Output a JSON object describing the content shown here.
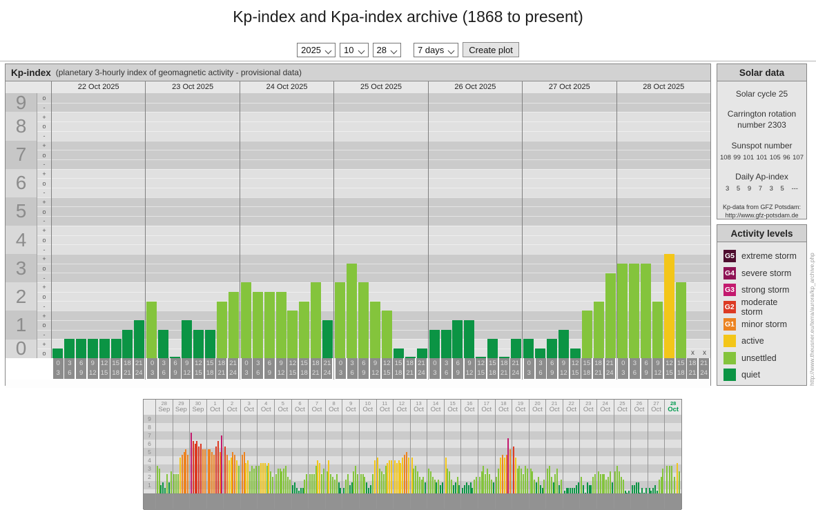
{
  "page": {
    "title": "Kp-index and Kpa-index archive (1868 to present)"
  },
  "controls": {
    "year": "2025",
    "month": "10",
    "day": "28",
    "range": "7 days",
    "create_button": "Create plot"
  },
  "main_chart": {
    "title": "Kp-index",
    "subtitle": "(planetary 3-hourly index of geomagnetic activity - provisional data)",
    "y_labels": [
      "9",
      "8",
      "7",
      "6",
      "5",
      "4",
      "3",
      "2",
      "1",
      "0"
    ],
    "hour_labels": [
      [
        "0",
        "3"
      ],
      [
        "3",
        "6"
      ],
      [
        "6",
        "9"
      ],
      [
        "9",
        "12"
      ],
      [
        "12",
        "15"
      ],
      [
        "15",
        "18"
      ],
      [
        "18",
        "21"
      ],
      [
        "21",
        "24"
      ]
    ],
    "no_data_marker": "x"
  },
  "solar_data": {
    "title": "Solar data",
    "solar_cycle": "Solar cycle 25",
    "carrington": "Carrington rotation number 2303",
    "sunspot_label": "Sunspot number",
    "sunspot_values": [
      "108",
      "99",
      "101",
      "101",
      "105",
      "96",
      "107"
    ],
    "ap_label": "Daily Ap-index",
    "ap_values": [
      "3",
      "5",
      "9",
      "7",
      "3",
      "5",
      "---"
    ],
    "source_line1": "Kp-data from GFZ Potsdam:",
    "source_line2": "http://www.gfz-potsdam.de"
  },
  "activity_levels": {
    "title": "Activity levels",
    "items": [
      {
        "badge": "G5",
        "label": "extreme storm",
        "color": "#4d0d2e"
      },
      {
        "badge": "G4",
        "label": "severe storm",
        "color": "#8e1254"
      },
      {
        "badge": "G3",
        "label": "strong storm",
        "color": "#c31a6e"
      },
      {
        "badge": "G2",
        "label": "moderate storm",
        "color": "#dc3a23"
      },
      {
        "badge": "G1",
        "label": "minor storm",
        "color": "#ec8321"
      },
      {
        "badge": "",
        "label": "active",
        "color": "#f3c619"
      },
      {
        "badge": "",
        "label": "unsettled",
        "color": "#84c43c"
      },
      {
        "badge": "",
        "label": "quiet",
        "color": "#0b9444"
      }
    ]
  },
  "palette": {
    "g5": "#4d0d2e",
    "g4": "#8e1254",
    "g3": "#c31a6e",
    "g2": "#dc3a23",
    "g1": "#ec8321",
    "active": "#f3c619",
    "unsettled": "#84c43c",
    "quiet": "#0b9444",
    "band_dark": "#cbcbcb",
    "band_light": "#e0e0e0",
    "axis_dark": "#c7c7c7",
    "axis_light": "#d9d9d9"
  },
  "watermark": "http://www.theusner.eu/terra/aurora/kp_archive.php",
  "chart_data": [
    {
      "type": "bar",
      "title": "Kp-index",
      "ylabel": "Kp",
      "ylim": [
        0,
        9
      ],
      "grid": true,
      "x_bins_hours": [
        [
          0,
          3
        ],
        [
          3,
          6
        ],
        [
          6,
          9
        ],
        [
          9,
          12
        ],
        [
          12,
          15
        ],
        [
          15,
          18
        ],
        [
          18,
          21
        ],
        [
          21,
          24
        ]
      ],
      "days": [
        {
          "date": "22 Oct 2025",
          "values": [
            0.33,
            0.67,
            0.67,
            0.67,
            0.67,
            0.67,
            1.0,
            1.33
          ]
        },
        {
          "date": "23 Oct 2025",
          "values": [
            2.0,
            1.0,
            0.0,
            1.33,
            1.0,
            1.0,
            2.0,
            2.33
          ]
        },
        {
          "date": "24 Oct 2025",
          "values": [
            2.67,
            2.33,
            2.33,
            2.33,
            1.67,
            2.0,
            2.67,
            1.33
          ]
        },
        {
          "date": "25 Oct 2025",
          "values": [
            2.67,
            3.33,
            2.67,
            2.0,
            1.67,
            0.33,
            0.0,
            0.33
          ]
        },
        {
          "date": "26 Oct 2025",
          "values": [
            1.0,
            1.0,
            1.33,
            1.33,
            0.0,
            0.67,
            0.0,
            0.67
          ]
        },
        {
          "date": "27 Oct 2025",
          "values": [
            0.67,
            0.33,
            0.67,
            1.0,
            0.33,
            1.67,
            2.0,
            3.0
          ]
        },
        {
          "date": "28 Oct 2025",
          "values": [
            3.33,
            3.33,
            3.33,
            2.0,
            3.67,
            2.67,
            null,
            null
          ]
        }
      ]
    },
    {
      "type": "bar",
      "title": "Kp overview 28 Sep - 28 Oct",
      "ylim": [
        0,
        9
      ],
      "y_labels": [
        "9",
        "8",
        "7",
        "6",
        "5",
        "4",
        "3",
        "2",
        "1"
      ],
      "selected_day": "28 Oct",
      "days": [
        {
          "day": "28",
          "month": "Sep",
          "values": [
            3.33,
            3.0,
            1.0,
            1.33,
            0.67,
            2.33,
            1.33,
            2.67
          ]
        },
        {
          "day": "29",
          "month": "Sep",
          "values": [
            2.33,
            2.33,
            2.33,
            4.33,
            4.67,
            5.0,
            5.33,
            4.67
          ]
        },
        {
          "day": "30",
          "month": "Sep",
          "values": [
            7.33,
            6.33,
            6.0,
            6.33,
            5.67,
            6.0,
            5.33,
            5.33
          ]
        },
        {
          "day": "1",
          "month": "Oct",
          "values": [
            5.33,
            5.33,
            5.0,
            4.67,
            5.67,
            6.33,
            5.0,
            7.0
          ]
        },
        {
          "day": "2",
          "month": "Oct",
          "values": [
            5.67,
            4.67,
            4.0,
            4.33,
            5.0,
            4.67,
            4.0,
            3.33
          ]
        },
        {
          "day": "3",
          "month": "Oct",
          "values": [
            4.67,
            5.0,
            3.67,
            4.0,
            2.67,
            3.33,
            3.0,
            3.33
          ]
        },
        {
          "day": "4",
          "month": "Oct",
          "values": [
            3.33,
            3.67,
            3.67,
            3.67,
            3.33,
            3.67,
            2.67,
            2.0
          ]
        },
        {
          "day": "5",
          "month": "Oct",
          "values": [
            2.33,
            3.0,
            3.0,
            2.67,
            3.0,
            3.33,
            2.0,
            1.67
          ]
        },
        {
          "day": "6",
          "month": "Oct",
          "values": [
            1.0,
            1.33,
            0.67,
            0.33,
            0.67,
            0.67,
            1.67,
            2.33
          ]
        },
        {
          "day": "7",
          "month": "Oct",
          "values": [
            2.33,
            2.33,
            2.33,
            3.33,
            4.0,
            3.67,
            2.33,
            3.0
          ]
        },
        {
          "day": "8",
          "month": "Oct",
          "values": [
            2.67,
            4.0,
            2.33,
            2.0,
            1.67,
            2.33,
            1.33,
            0.67
          ]
        },
        {
          "day": "9",
          "month": "Oct",
          "values": [
            0.67,
            1.67,
            2.33,
            1.0,
            1.33,
            2.67,
            3.33,
            2.33
          ]
        },
        {
          "day": "10",
          "month": "Oct",
          "values": [
            2.33,
            2.33,
            2.0,
            1.33,
            0.67,
            1.0,
            2.33,
            4.0
          ]
        },
        {
          "day": "11",
          "month": "Oct",
          "values": [
            4.33,
            3.0,
            2.67,
            2.33,
            3.33,
            3.67,
            4.0,
            4.0
          ]
        },
        {
          "day": "12",
          "month": "Oct",
          "values": [
            4.0,
            3.67,
            4.0,
            3.67,
            4.33,
            4.67,
            5.0,
            4.33
          ]
        },
        {
          "day": "13",
          "month": "Oct",
          "values": [
            4.33,
            3.0,
            3.33,
            2.67,
            2.0,
            1.67,
            2.0,
            1.33
          ]
        },
        {
          "day": "14",
          "month": "Oct",
          "values": [
            3.0,
            2.67,
            2.0,
            1.67,
            1.33,
            1.67,
            1.0,
            1.33
          ]
        },
        {
          "day": "15",
          "month": "Oct",
          "values": [
            4.33,
            3.0,
            2.67,
            1.67,
            1.0,
            1.33,
            2.0,
            1.0
          ]
        },
        {
          "day": "16",
          "month": "Oct",
          "values": [
            0.67,
            1.0,
            1.33,
            1.0,
            1.33,
            0.67,
            1.67,
            2.0
          ]
        },
        {
          "day": "17",
          "month": "Oct",
          "values": [
            2.0,
            2.67,
            3.33,
            2.33,
            3.0,
            2.33,
            1.67,
            1.33
          ]
        },
        {
          "day": "18",
          "month": "Oct",
          "values": [
            2.0,
            3.0,
            4.33,
            4.67,
            4.33,
            4.67,
            6.67,
            5.33
          ]
        },
        {
          "day": "19",
          "month": "Oct",
          "values": [
            5.67,
            4.33,
            3.0,
            3.33,
            3.0,
            2.33,
            3.33,
            3.0
          ]
        },
        {
          "day": "20",
          "month": "Oct",
          "values": [
            3.0,
            2.67,
            1.67,
            1.33,
            2.0,
            1.0,
            0.67,
            1.67
          ]
        },
        {
          "day": "21",
          "month": "Oct",
          "values": [
            3.0,
            3.33,
            2.0,
            1.33,
            2.33,
            3.0,
            1.0,
            1.67
          ]
        },
        {
          "day": "22",
          "month": "Oct",
          "values": [
            0.33,
            0.67,
            0.67,
            0.67,
            0.67,
            0.67,
            1.0,
            1.33
          ]
        },
        {
          "day": "23",
          "month": "Oct",
          "values": [
            2.0,
            1.0,
            0.0,
            1.33,
            1.0,
            1.0,
            2.0,
            2.33
          ]
        },
        {
          "day": "24",
          "month": "Oct",
          "values": [
            2.67,
            2.33,
            2.33,
            2.33,
            1.67,
            2.0,
            2.67,
            1.33
          ]
        },
        {
          "day": "25",
          "month": "Oct",
          "values": [
            2.67,
            3.33,
            2.67,
            2.0,
            1.67,
            0.33,
            0.0,
            0.33
          ]
        },
        {
          "day": "26",
          "month": "Oct",
          "values": [
            1.0,
            1.0,
            1.33,
            1.33,
            0.0,
            0.67,
            0.0,
            0.67
          ]
        },
        {
          "day": "27",
          "month": "Oct",
          "values": [
            0.67,
            0.33,
            0.67,
            1.0,
            0.33,
            1.67,
            2.0,
            3.0
          ]
        },
        {
          "day": "28",
          "month": "Oct",
          "values": [
            3.33,
            3.33,
            3.33,
            2.0,
            3.67,
            2.67
          ],
          "selected": true
        }
      ]
    }
  ]
}
